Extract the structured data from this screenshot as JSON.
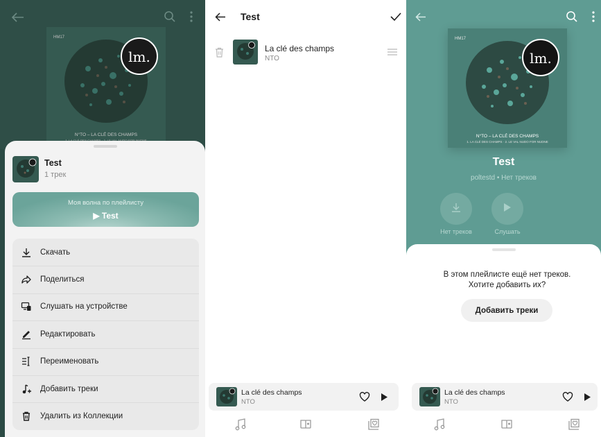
{
  "colors": {
    "dark_teal": "#2f4e47",
    "teal": "#5f9c93",
    "wave_gradient": "#8fbdb4",
    "sheet_bg": "#f3f3f3"
  },
  "panel1": {
    "playlist_title": "Test",
    "playlist_count": "1 трек",
    "wave_line1": "Моя волна по плейлисту",
    "wave_line2": "▶ Test",
    "menu": [
      {
        "label": "Скачать",
        "icon": "download-icon"
      },
      {
        "label": "Поделиться",
        "icon": "share-icon"
      },
      {
        "label": "Слушать на устройстве",
        "icon": "device-icon"
      },
      {
        "label": "Редактировать",
        "icon": "edit-icon"
      },
      {
        "label": "Переименовать",
        "icon": "rename-icon"
      },
      {
        "label": "Добавить треки",
        "icon": "add-track-icon"
      },
      {
        "label": "Удалить из Коллекции",
        "icon": "trash-icon"
      }
    ]
  },
  "panel2": {
    "title": "Test",
    "track": {
      "name": "La clé des champs",
      "artist": "NTO"
    }
  },
  "panel3": {
    "title": "Test",
    "subtitle": "poltestd • Нет треков",
    "btn_download_label": "Нет треков",
    "btn_play_label": "Слушать",
    "empty_line1": "В этом плейлисте ещё нет треков.",
    "empty_line2": "Хотите добавить их?",
    "add_button": "Добавить треки"
  },
  "cover": {
    "label_tl": "HM17",
    "logo": "lm.",
    "line1": "N°TO – LA CLÉ DES CHAMPS",
    "line2": "1. LA CLÉ DES CHAMPS · 2. LE VAL NUDO FOR NUDNE"
  },
  "player": {
    "track": "La clé des champs",
    "artist": "NTO"
  },
  "nav": [
    "music-note-icon",
    "podcast-icon",
    "collection-icon"
  ]
}
